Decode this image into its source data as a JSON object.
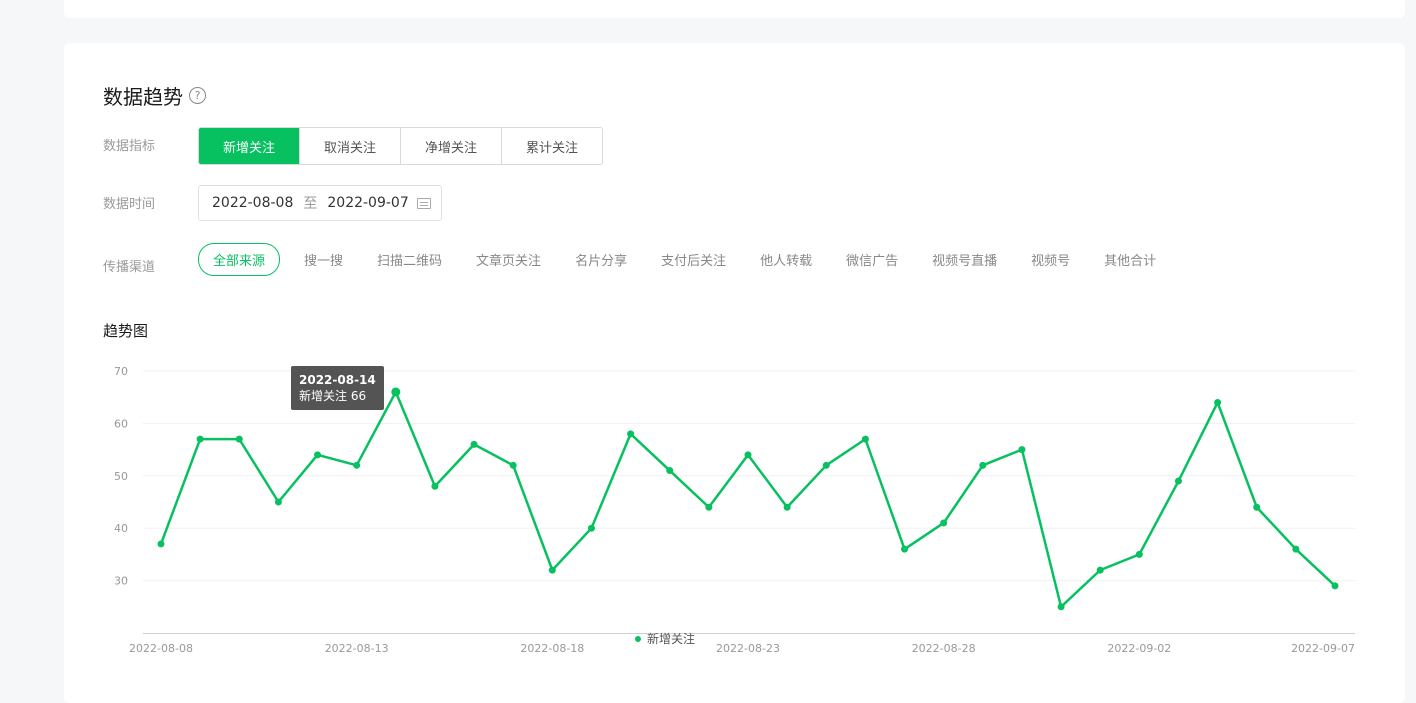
{
  "section": {
    "title": "数据趋势",
    "help_icon": "?"
  },
  "metrics": {
    "label": "数据指标",
    "options": [
      "新增关注",
      "取消关注",
      "净增关注",
      "累计关注"
    ],
    "selected": "新增关注"
  },
  "date_range": {
    "label": "数据时间",
    "start": "2022-08-08",
    "separator": "至",
    "end": "2022-09-07",
    "icon": "calendar-icon"
  },
  "channels": {
    "label": "传播渠道",
    "items": [
      "全部来源",
      "搜一搜",
      "扫描二维码",
      "文章页关注",
      "名片分享",
      "支付后关注",
      "他人转载",
      "微信广告",
      "视频号直播",
      "视频号",
      "其他合计"
    ],
    "selected": "全部来源"
  },
  "chart_title": "趋势图",
  "tooltip": {
    "date": "2022-08-14",
    "text": "新增关注 66"
  },
  "legend": {
    "label": "新增关注"
  },
  "colors": {
    "accent": "#07c160"
  },
  "chart_data": {
    "type": "line",
    "title": "趋势图",
    "x": [
      "2022-08-08",
      "2022-08-09",
      "2022-08-10",
      "2022-08-11",
      "2022-08-12",
      "2022-08-13",
      "2022-08-14",
      "2022-08-15",
      "2022-08-16",
      "2022-08-17",
      "2022-08-18",
      "2022-08-19",
      "2022-08-20",
      "2022-08-21",
      "2022-08-22",
      "2022-08-23",
      "2022-08-24",
      "2022-08-25",
      "2022-08-26",
      "2022-08-27",
      "2022-08-28",
      "2022-08-29",
      "2022-08-30",
      "2022-08-31",
      "2022-09-01",
      "2022-09-02",
      "2022-09-03",
      "2022-09-04",
      "2022-09-05",
      "2022-09-06",
      "2022-09-07"
    ],
    "series": [
      {
        "name": "新增关注",
        "values": [
          37,
          57,
          57,
          45,
          54,
          52,
          66,
          48,
          56,
          52,
          32,
          40,
          58,
          51,
          44,
          54,
          44,
          52,
          57,
          36,
          41,
          52,
          55,
          25,
          32,
          35,
          49,
          64,
          44,
          36,
          29
        ]
      }
    ],
    "x_tick_labels": [
      "2022-08-08",
      "2022-08-13",
      "2022-08-18",
      "2022-08-23",
      "2022-08-28",
      "2022-09-02",
      "2022-09-07"
    ],
    "y_ticks": [
      30,
      40,
      50,
      60,
      70
    ],
    "ylim": [
      20,
      70
    ],
    "grid": true,
    "legend_position": "bottom"
  }
}
